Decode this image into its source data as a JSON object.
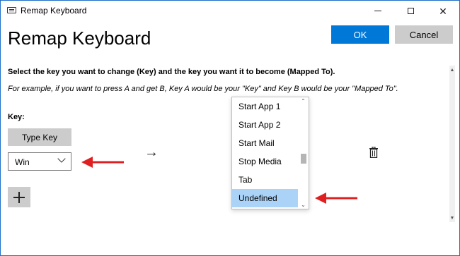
{
  "window": {
    "title": "Remap Keyboard",
    "controls": {
      "minimize": "—",
      "maximize": "☐",
      "close": "✕"
    }
  },
  "header": {
    "title": "Remap Keyboard",
    "ok_label": "OK",
    "cancel_label": "Cancel"
  },
  "instructions": {
    "main": "Select the key you want to change (Key) and the key you want it to become (Mapped To).",
    "example": "For example, if you want to press A and get B, Key A would be your \"Key\" and Key B would be your \"Mapped To\"."
  },
  "key_section": {
    "label": "Key:",
    "type_key_label": "Type Key",
    "selected_key": "Win"
  },
  "dropdown": {
    "items": [
      "Start App 1",
      "Start App 2",
      "Start Mail",
      "Stop Media",
      "Tab",
      "Undefined"
    ],
    "selected": "Undefined"
  },
  "colors": {
    "accent": "#0078d7",
    "selection": "#aad3f7",
    "annotation_arrow": "#e02020"
  },
  "icons": {
    "arrow": "right-arrow-icon",
    "trash": "trash-icon",
    "add": "plus-icon"
  }
}
